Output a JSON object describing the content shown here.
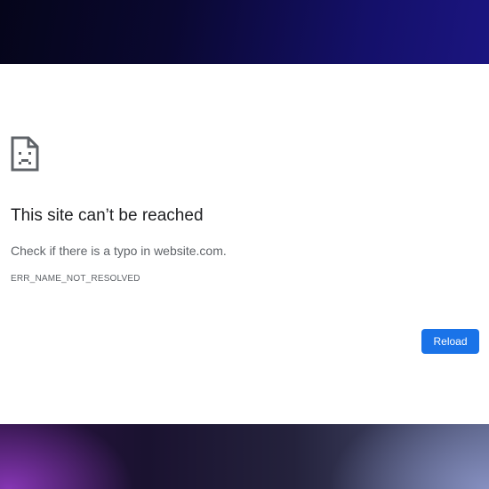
{
  "error_page": {
    "icon": "sad-page-icon",
    "title": "This site can’t be reached",
    "message": "Check if there is a typo in website.com.",
    "error_code": "ERR_NAME_NOT_RESOLVED",
    "reload_label": "Reload"
  },
  "colors": {
    "accent": "#1a73e8",
    "title_text": "#202124",
    "body_text": "#5f6368"
  }
}
